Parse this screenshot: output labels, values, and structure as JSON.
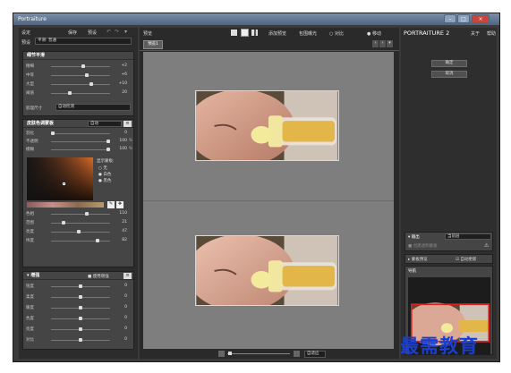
{
  "window": {
    "title": "Portraiture"
  },
  "left": {
    "header": "设定",
    "save": "保存",
    "restore": "预设",
    "preset_label": "预设",
    "preset_value": "平滑: 普通",
    "smoothing": {
      "title": "细节平滑",
      "sliders": [
        {
          "label": "精细",
          "value": "+2",
          "pos": 0.55
        },
        {
          "label": "中等",
          "value": "+6",
          "pos": 0.62
        },
        {
          "label": "大型",
          "value": "+10",
          "pos": 0.7
        },
        {
          "label": "阈值",
          "value": "20",
          "pos": 0.3
        }
      ],
      "size_label": "肌理尺寸",
      "size_value": "自动检测"
    },
    "skintone": {
      "title": "皮肤色调蒙板",
      "mode": "自动",
      "sliders_top": [
        {
          "label": "羽化",
          "value": "0",
          "unit": "",
          "pos": 0.0
        },
        {
          "label": "不透明",
          "value": "100",
          "unit": "%",
          "pos": 1.0
        },
        {
          "label": "模糊",
          "value": "100",
          "unit": "%",
          "pos": 1.0
        }
      ],
      "show_mask": "显示蒙板:",
      "options": [
        "无",
        "白色",
        "黑色"
      ],
      "sliders_bottom": [
        {
          "label": "色相",
          "value": "110",
          "pos": 0.62
        },
        {
          "label": "范围",
          "value": "21",
          "pos": 0.2
        },
        {
          "label": "亮度",
          "value": "47",
          "pos": 0.47
        },
        {
          "label": "纬度",
          "value": "82",
          "pos": 0.8
        }
      ]
    },
    "enhance": {
      "title": "增强",
      "toggle": "使用增强",
      "sliders": [
        {
          "label": "锐度",
          "value": "0"
        },
        {
          "label": "柔度",
          "value": "0"
        },
        {
          "label": "暖度",
          "value": "0"
        },
        {
          "label": "色度",
          "value": "0"
        },
        {
          "label": "亮度",
          "value": "0"
        },
        {
          "label": "对比",
          "value": "0"
        }
      ]
    }
  },
  "center": {
    "header": "预览",
    "menu": [
      "添加预览",
      "包围曝光",
      "对比"
    ],
    "move": "移动",
    "tab": "预览1",
    "zoom": "自适应"
  },
  "right": {
    "brand": "PORTRAITURE 2",
    "about": "关于",
    "help": "帮助",
    "ok": "确定",
    "cancel": "取消",
    "output": "输出",
    "output_value": "当前层",
    "output_opt": "创建透明蒙板",
    "compare": "蒙板预览",
    "auto_update": "自动更新",
    "navigator": "导航"
  },
  "watermark": "最需教育"
}
